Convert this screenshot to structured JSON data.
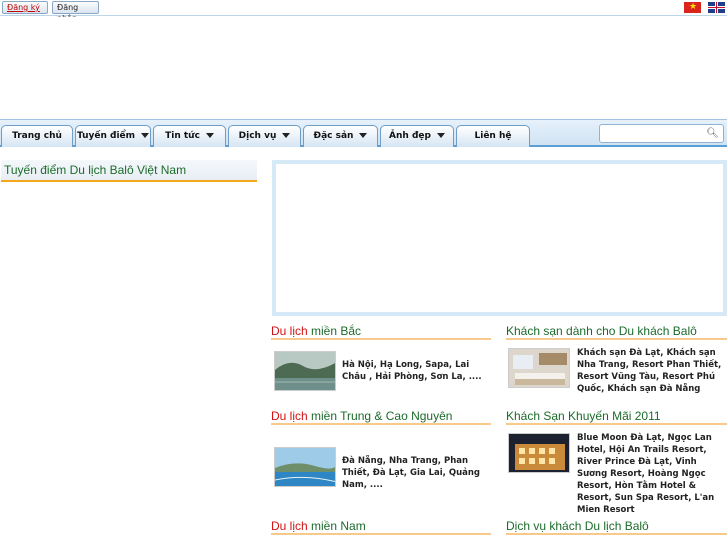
{
  "topbar": {
    "register_label": "Đăng ký",
    "login_label": "Đăng nhập"
  },
  "nav": {
    "items": [
      {
        "label": "Trang chủ"
      },
      {
        "label": "Tuyến điểm"
      },
      {
        "label": "Tin tức"
      },
      {
        "label": "Dịch vụ"
      },
      {
        "label": "Đặc sản"
      },
      {
        "label": "Ảnh đẹp"
      },
      {
        "label": "Liên hệ"
      }
    ],
    "search_value": ""
  },
  "left": {
    "heading": "Tuyến điểm Du lịch Balô Việt Nam"
  },
  "sections": {
    "north": {
      "title_red": "Du lịch",
      "title_green": " miền Bắc",
      "desc": "Hà Nội, Hạ Long, Sapa, Lai Châu , Hải Phòng, Sơn La, ...."
    },
    "central": {
      "title_red": "Du lịch",
      "title_green": " miền Trung & Cao Nguyên",
      "desc": "Đà Nẵng, Nha Trang, Phan Thiết, Đà Lạt, Gia Lai, Quảng Nam, ...."
    },
    "south": {
      "title_red": "Du lịch",
      "title_green": " miền Nam"
    },
    "hotels": {
      "title": "Khách sạn dành cho Du khách Balô",
      "desc": "Khách sạn Đà Lạt, Khách sạn Nha Trang, Resort Phan Thiết, Resort Vũng Tàu, Resort Phú Quốc, Khách sạn Đà Nẵng"
    },
    "promo": {
      "title": "Khách Sạn Khuyến Mãi 2011",
      "desc": "Blue Moon Đà Lạt, Ngọc Lan Hotel, Hội An Trails Resort, River Prince Đà Lạt, Vinh Sương Resort, Hoàng Ngọc Resort, Hòn Tằm Hotel & Resort, Sun Spa Resort, L'an Mien Resort"
    },
    "services": {
      "title": "Dịch vụ khách Du lịch Balô"
    }
  },
  "icons": {
    "search": "search-icon",
    "flag_vn": "vietnam-flag-icon",
    "flag_en": "uk-flag-icon",
    "caret": "chevron-down-icon"
  },
  "colors": {
    "accent_red": "#d11414",
    "accent_green": "#1c6b2b",
    "underline": "#f7c98a",
    "nav_border": "#5aa0d6"
  }
}
